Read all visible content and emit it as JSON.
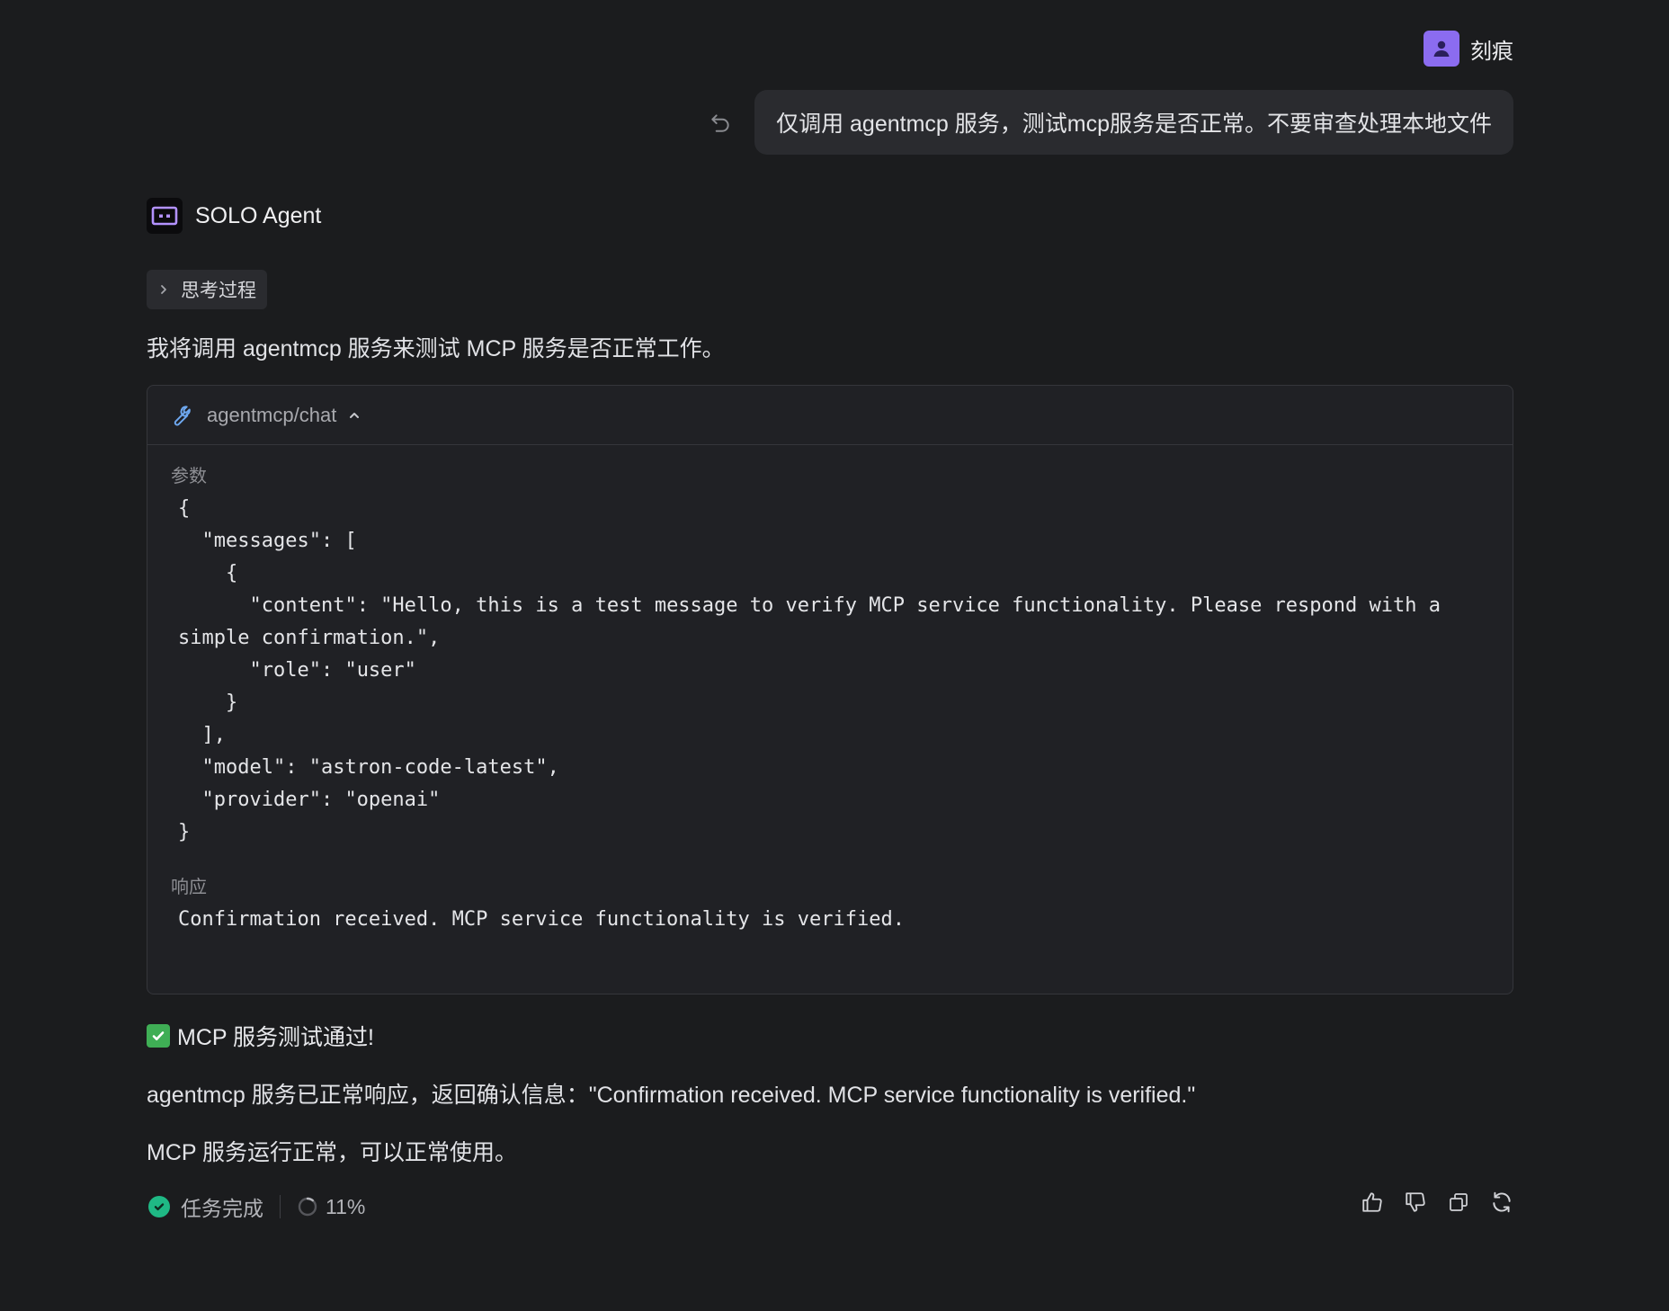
{
  "user": {
    "name": "刻痕",
    "message": "仅调用 agentmcp 服务，测试mcp服务是否正常。不要审查处理本地文件"
  },
  "agent": {
    "name": "SOLO Agent",
    "thinking_label": "思考过程",
    "intro": "我将调用 agentmcp 服务来测试 MCP 服务是否正常工作。"
  },
  "tool_call": {
    "name": "agentmcp/chat",
    "params_label": "参数",
    "params_code": "{\n  \"messages\": [\n    {\n      \"content\": \"Hello, this is a test message to verify MCP service functionality. Please respond with a simple confirmation.\",\n      \"role\": \"user\"\n    }\n  ],\n  \"model\": \"astron-code-latest\",\n  \"provider\": \"openai\"\n}",
    "response_label": "响应",
    "response_text": "Confirmation received. MCP service functionality is verified."
  },
  "summary": {
    "title": "MCP 服务测试通过!",
    "line1": "agentmcp 服务已正常响应，返回确认信息：\"Confirmation received. MCP service functionality is verified.\"",
    "line2": "MCP 服务运行正常，可以正常使用。"
  },
  "footer": {
    "status_text": "任务完成",
    "progress_text": "11%",
    "progress_value": 0.11
  },
  "colors": {
    "background": "#1b1c1e",
    "accent_purple": "#8b6cf0",
    "success_green": "#1fb985",
    "wrench_blue": "#6ea8f0"
  },
  "icons": {
    "user_avatar": "person-icon",
    "undo": "undo-icon",
    "agent_logo": "agent-logo-icon",
    "thinking_toggle": "chevron-right-icon",
    "tool": "wrench-icon",
    "collapse": "chevron-up-icon",
    "summary_check": "check-box-icon",
    "status": "check-circle-icon",
    "progress": "progress-ring-icon",
    "like": "thumbs-up-icon",
    "dislike": "thumbs-down-icon",
    "copy": "copy-icon",
    "regenerate": "refresh-icon"
  }
}
